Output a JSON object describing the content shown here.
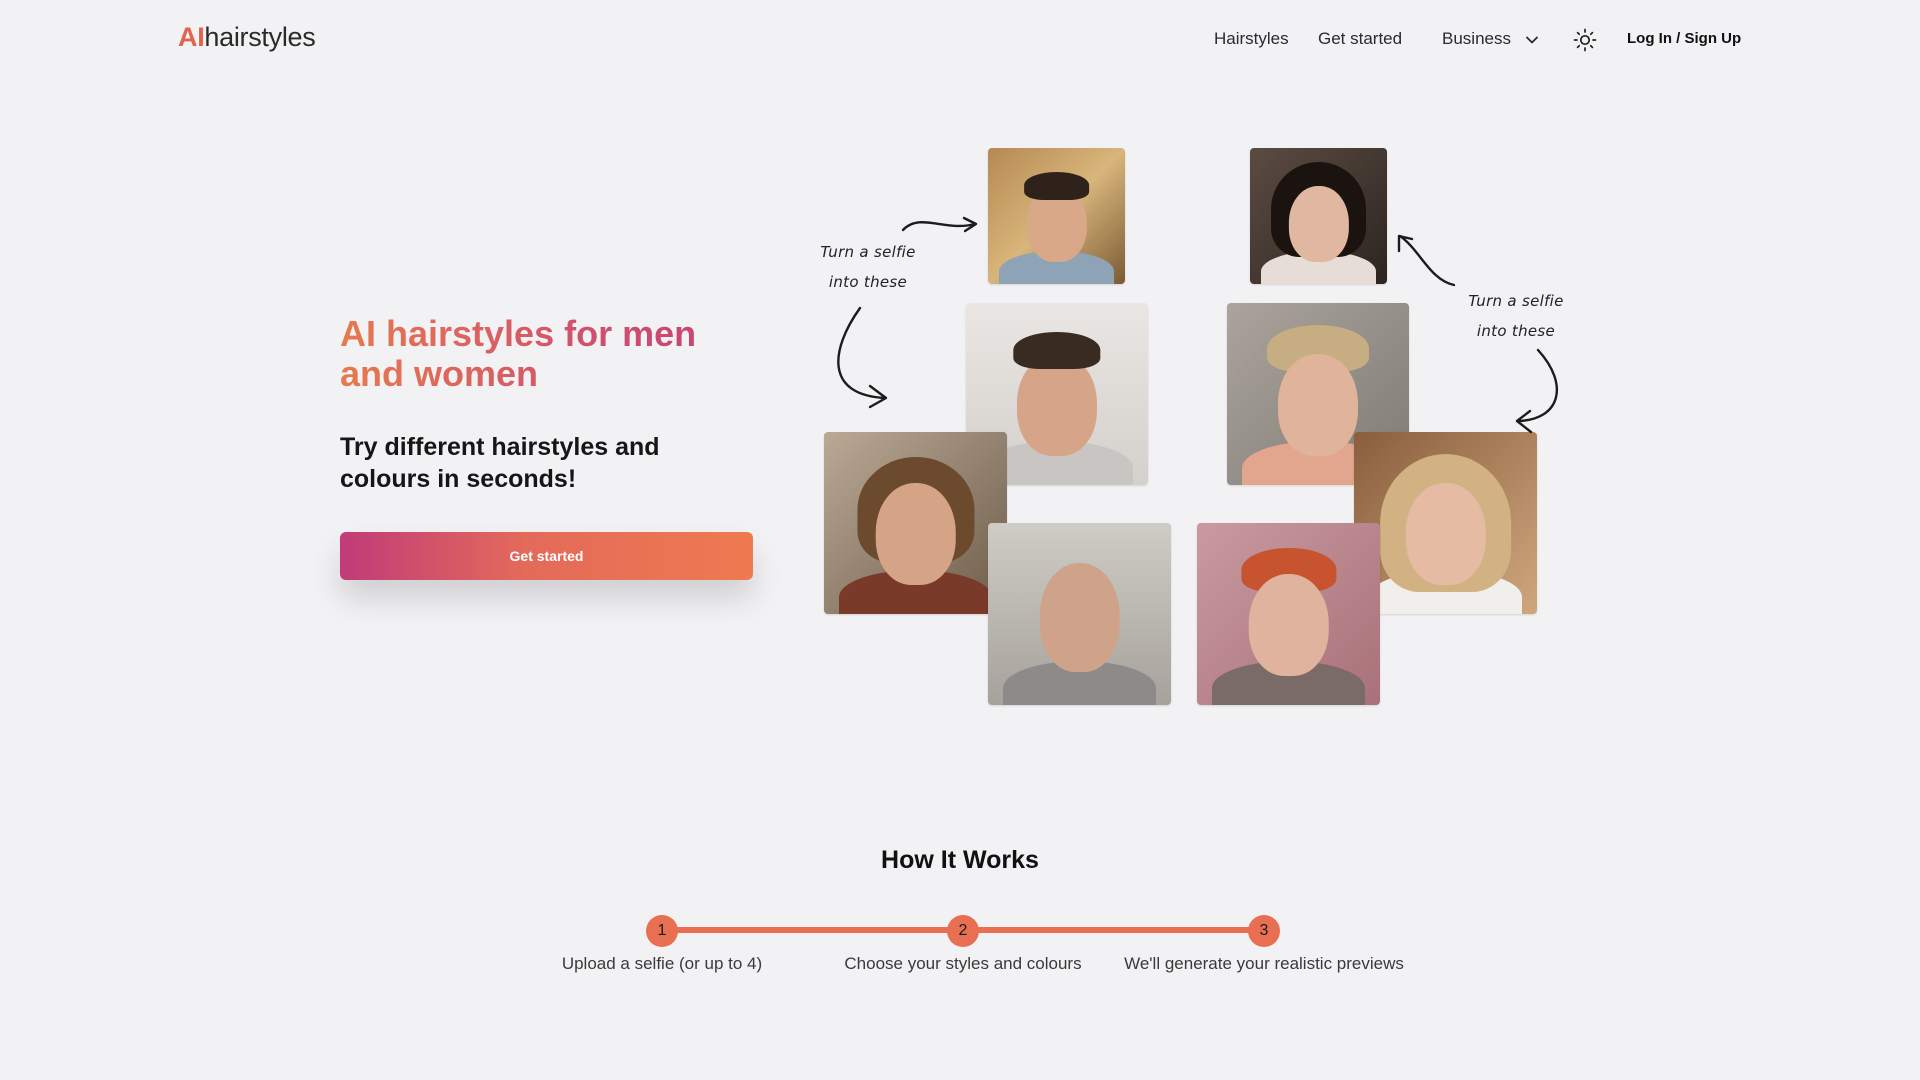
{
  "header": {
    "logo_ai": "AI",
    "logo_rest": "hairstyles",
    "nav": {
      "hairstyles": "Hairstyles",
      "get_started": "Get started",
      "business": "Business"
    },
    "login": "Log In / Sign Up"
  },
  "hero": {
    "title": "AI hairstyles for men and women",
    "subtitle": "Try different hairstyles and colours in seconds!",
    "cta": "Get started",
    "accent_colors": [
      "#e67a4e",
      "#c43e72"
    ]
  },
  "annotations": {
    "left_line1": "Turn a selfie",
    "left_line2": "into these",
    "right_line1": "Turn a selfie",
    "right_line2": "into these"
  },
  "how_it_works": {
    "title": "How It Works",
    "steps": [
      {
        "number": "1",
        "label": "Upload a selfie (or up to 4)"
      },
      {
        "number": "2",
        "label": "Choose your styles and colours"
      },
      {
        "number": "3",
        "label": "We'll generate your realistic previews"
      }
    ],
    "accent_color": "#e86f52"
  }
}
